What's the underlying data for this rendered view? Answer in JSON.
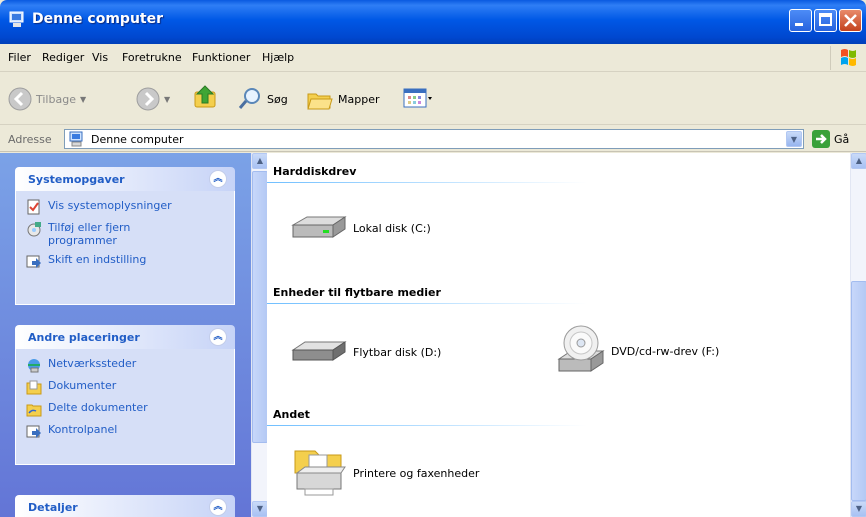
{
  "window": {
    "title": "Denne computer"
  },
  "menu": [
    "Filer",
    "Rediger",
    "Vis",
    "Foretrukne",
    "Funktioner",
    "Hjælp"
  ],
  "toolbar": {
    "back_label": "Tilbage",
    "search_label": "Søg",
    "folders_label": "Mapper"
  },
  "address": {
    "label": "Adresse",
    "value": "Denne computer",
    "go_label": "Gå"
  },
  "sidebar": {
    "system_tasks": {
      "title": "Systemopgaver",
      "items": [
        "Vis systemoplysninger",
        "Tilføj eller fjern programmer",
        "Skift en indstilling"
      ]
    },
    "other_places": {
      "title": "Andre placeringer",
      "items": [
        "Netværkssteder",
        "Dokumenter",
        "Delte dokumenter",
        "Kontrolpanel"
      ]
    },
    "details": {
      "title": "Detaljer"
    }
  },
  "content": {
    "sections": [
      {
        "title": "Harddiskdrev",
        "items": [
          "Lokal disk (C:)"
        ]
      },
      {
        "title": "Enheder til flytbare medier",
        "items": [
          "Flytbar disk (D:)",
          "DVD/cd-rw-drev (F:)"
        ]
      },
      {
        "title": "Andet",
        "items": [
          "Printere og faxenheder"
        ]
      }
    ]
  },
  "colors": {
    "titlebar": "#0058e6",
    "taskpane_bg": "#6f8ee0",
    "task_link": "#215dc6"
  }
}
